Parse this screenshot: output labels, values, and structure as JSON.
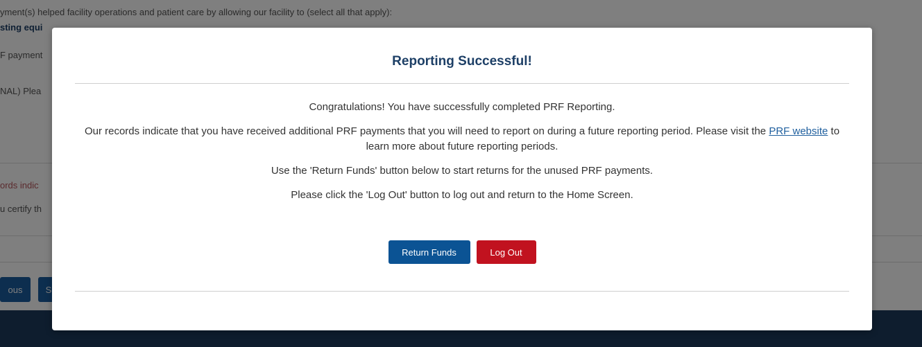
{
  "background": {
    "line1": "yment(s) helped facility operations and patient care by allowing our facility to (select all that apply):",
    "line2": "sting equi",
    "line3": "F payment",
    "line4": "NAL) Plea",
    "line5": "ords indic",
    "line6": "u certify th",
    "prev_button": "ous",
    "next_button": "S"
  },
  "modal": {
    "title": "Reporting Successful!",
    "para1": "Congratulations! You have successfully completed PRF Reporting.",
    "para2_before": "Our records indicate that you have received additional PRF payments that you will need to report on during a future reporting period. Please visit the",
    "para2_link": "PRF website",
    "para2_after": "to learn more about future reporting periods.",
    "para3": "Use the 'Return Funds' button below to start returns for the unused PRF payments.",
    "para4": "Please click the 'Log Out' button to log out and return to the Home Screen.",
    "return_funds_label": "Return Funds",
    "log_out_label": "Log Out"
  },
  "colors": {
    "title": "#1d3f66",
    "primary_button": "#0b5394",
    "danger_button": "#c1121f",
    "link": "#1f5f9e",
    "footer": "#1d3a5c"
  }
}
